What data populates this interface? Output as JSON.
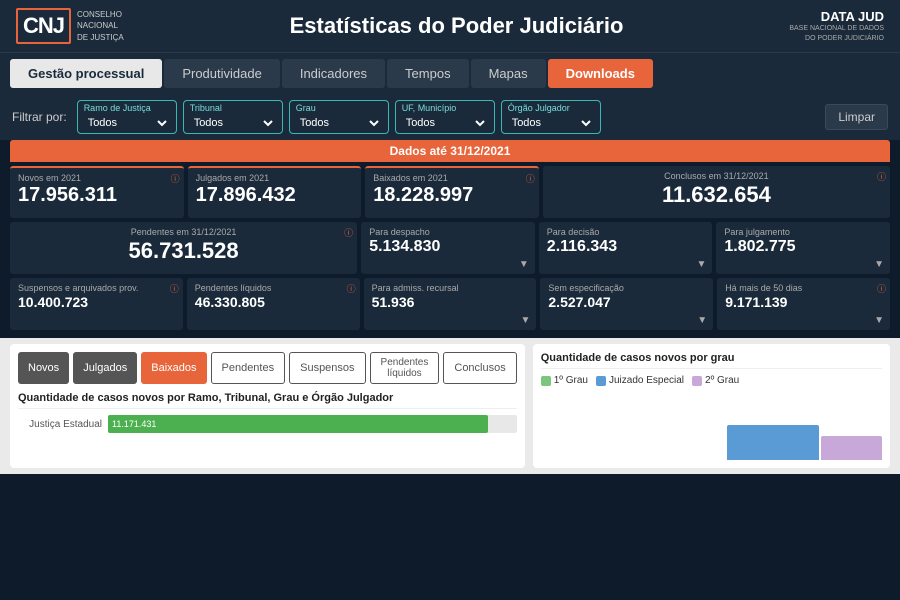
{
  "header": {
    "title": "Estatísticas do Poder Judiciário",
    "cnj_abbr": "CNJ",
    "cnj_full_line1": "CONSELHO",
    "cnj_full_line2": "NACIONAL",
    "cnj_full_line3": "DE JUSTIÇA",
    "datajud_brand": "DATA JUD",
    "datajud_sub": "BASE NACIONAL DE DADOS\nDO PODER JUDICIÁRIO"
  },
  "nav": {
    "items": [
      {
        "label": "Gestão processual",
        "active": true
      },
      {
        "label": "Produtividade",
        "active": false
      },
      {
        "label": "Indicadores",
        "active": false
      },
      {
        "label": "Tempos",
        "active": false
      },
      {
        "label": "Mapas",
        "active": false
      },
      {
        "label": "Downloads",
        "active": false,
        "highlight": true
      }
    ]
  },
  "filter": {
    "label": "Filtrar por:",
    "limpar": "Limpar",
    "fields": [
      {
        "name": "Ramo de Justiça",
        "value": "Todos"
      },
      {
        "name": "Tribunal",
        "value": "Todos"
      },
      {
        "name": "Grau",
        "value": "Todos"
      },
      {
        "name": "UF, Município",
        "value": "Todos"
      },
      {
        "name": "Órgão Julgador",
        "value": "Todos"
      }
    ]
  },
  "data_header": "Dados até 31/12/2021",
  "stats": {
    "row1": [
      {
        "title": "Novos em 2021",
        "value": "17.956.311",
        "info": true
      },
      {
        "title": "Julgados em 2021",
        "value": "17.896.432",
        "info": false
      },
      {
        "title": "Baixados em 2021",
        "value": "18.228.997",
        "info": true
      },
      {
        "title": "Conclusos em 31/12/2021",
        "value": "11.632.654",
        "info": true,
        "wide": true
      }
    ],
    "row2": [
      {
        "title": "Pendentes em 31/12/2021",
        "value": "56.731.528",
        "info": true,
        "wide": true
      },
      {
        "title": "Para despacho",
        "value": "5.134.830",
        "down": true
      },
      {
        "title": "Para decisão",
        "value": "2.116.343",
        "down": true
      },
      {
        "title": "Para julgamento",
        "value": "1.802.775",
        "down": true
      }
    ],
    "row3": [
      {
        "title": "Suspensos e arquivados prov.",
        "value": "10.400.723",
        "info": true
      },
      {
        "title": "Pendentes líquidos",
        "value": "46.330.805",
        "info": true
      },
      {
        "title": "Para admiss. recursal",
        "value": "51.936",
        "down": true
      },
      {
        "title": "Sem especificação",
        "value": "2.527.047",
        "down": true
      },
      {
        "title": "Há mais de 50 dias",
        "value": "9.171.139",
        "info": true,
        "down": true
      }
    ]
  },
  "chart_buttons": [
    {
      "label": "Novos",
      "style": "gray"
    },
    {
      "label": "Julgados",
      "style": "gray"
    },
    {
      "label": "Baixados",
      "style": "orange"
    },
    {
      "label": "Pendentes",
      "style": "outline"
    },
    {
      "label": "Suspensos",
      "style": "outline"
    },
    {
      "label": "Pendentes líquidos",
      "style": "outline"
    },
    {
      "label": "Conclusos",
      "style": "outline"
    }
  ],
  "left_chart": {
    "title": "Quantidade de casos novos por Ramo, Tribunal, Grau e Órgão Julgador",
    "bars": [
      {
        "label": "Justiça Estadual",
        "value": 11171431,
        "max": 12000000,
        "display": "11.171.431"
      }
    ]
  },
  "right_chart": {
    "title": "Quantidade de casos novos por grau",
    "legend": [
      {
        "label": "1º Grau",
        "color": "#7bc67e"
      },
      {
        "label": "Juizado Especial",
        "color": "#5b9bd5"
      },
      {
        "label": "2º Grau",
        "color": "#c8a8d8"
      }
    ]
  }
}
